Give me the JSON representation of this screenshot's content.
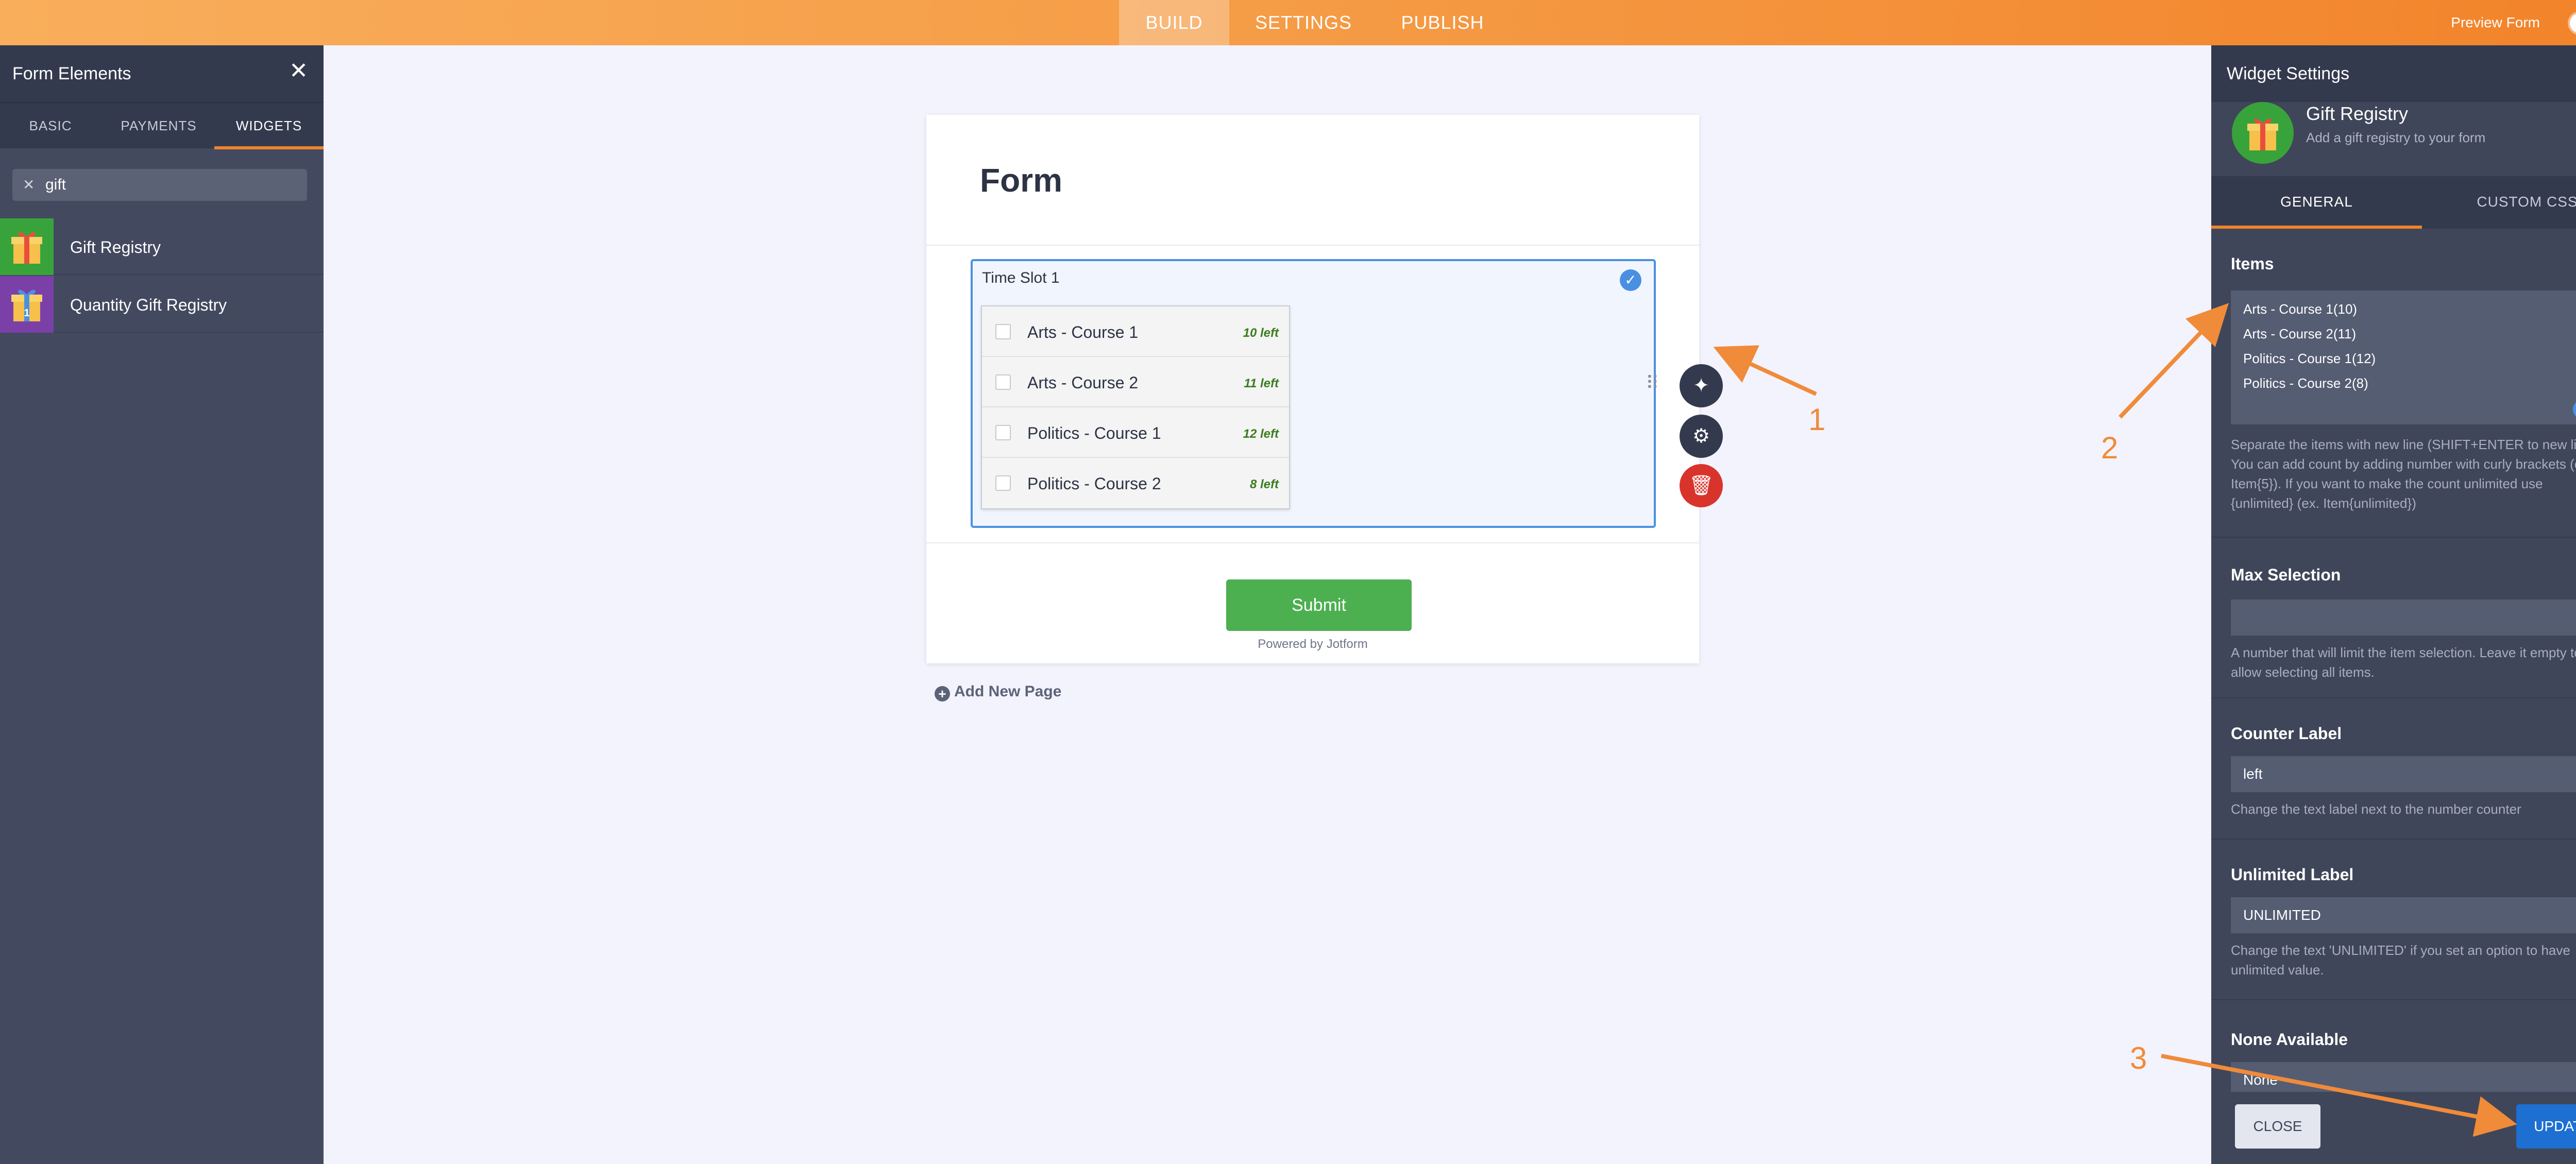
{
  "topbar": {
    "tabs": [
      {
        "label": "BUILD",
        "active": true
      },
      {
        "label": "SETTINGS",
        "active": false
      },
      {
        "label": "PUBLISH",
        "active": false
      }
    ],
    "preview_label": "Preview Form",
    "preview_enabled": false
  },
  "left_panel": {
    "title": "Form Elements",
    "tabs": [
      {
        "label": "BASIC",
        "active": false
      },
      {
        "label": "PAYMENTS",
        "active": false
      },
      {
        "label": "WIDGETS",
        "active": true
      }
    ],
    "search_value": "gift",
    "items": [
      {
        "label": "Gift Registry",
        "icon": "gift-icon",
        "color": "#39a33b"
      },
      {
        "label": "Quantity Gift Registry",
        "icon": "gift-icon",
        "color": "#7b3fa8"
      }
    ]
  },
  "form": {
    "title": "Form",
    "field_label": "Time Slot 1",
    "items": [
      {
        "name": "Arts - Course 1",
        "count": "10 left"
      },
      {
        "name": "Arts - Course 2",
        "count": "11 left"
      },
      {
        "name": "Politics - Course 1",
        "count": "12 left"
      },
      {
        "name": "Politics - Course 2",
        "count": "8 left"
      }
    ],
    "submit_label": "Submit",
    "powered_by": "Powered by Jotform",
    "add_page_label": "Add New Page"
  },
  "right_panel": {
    "title": "Widget Settings",
    "widget_name": "Gift Registry",
    "widget_desc": "Add a gift registry to your form",
    "tabs": [
      {
        "label": "GENERAL",
        "active": true
      },
      {
        "label": "CUSTOM CSS",
        "active": false
      }
    ],
    "items_label": "Items",
    "items_lines": [
      "Arts - Course 1(10)",
      "Arts - Course 2(11)",
      "Politics - Course 1(12)",
      "Politics - Course 2(8)"
    ],
    "items_help": "Separate the items with new line (SHIFT+ENTER to new line). You can add count by adding number with curly brackets (ex. Item{5}). If you want to make the count unlimited use {unlimited} (ex. Item{unlimited})",
    "max_label": "Max Selection",
    "max_value": "",
    "max_help": "A number that will limit the item selection. Leave it empty to allow selecting all items.",
    "counter_label": "Counter Label",
    "counter_value": "left",
    "counter_help": "Change the text label next to the number counter",
    "unlimited_label": "Unlimited Label",
    "unlimited_value": "UNLIMITED",
    "unlimited_help": "Change the text 'UNLIMITED' if you set an option to have unlimited value.",
    "none_label": "None Available",
    "none_value": "None",
    "close_label": "CLOSE",
    "update_label": "UPDATE"
  },
  "annotations": [
    "1",
    "2",
    "3"
  ],
  "colors": {
    "accent": "#f2832a",
    "field_border": "#4a90e2",
    "submit": "#4caf50",
    "update": "#1d6fd1",
    "delete": "#d9342b"
  }
}
